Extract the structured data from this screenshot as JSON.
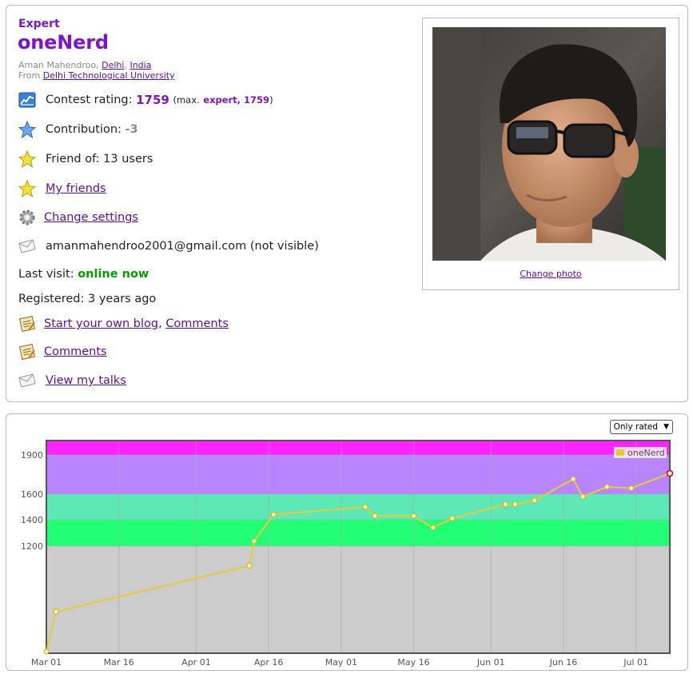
{
  "profile": {
    "rank": "Expert",
    "handle": "oneNerd",
    "name": "Aman Mahendroo",
    "city": "Delhi",
    "country": "India",
    "from_label": "From",
    "organization": "Delhi Technological University",
    "rating_label": "Contest rating:",
    "rating_value": "1759",
    "max_open": "(max.",
    "max_value": "expert, 1759",
    "max_close": ")",
    "contribution_label": "Contribution:",
    "contribution_value": "-3",
    "friend_of": "Friend of: 13 users",
    "my_friends": "My friends",
    "change_settings": "Change settings",
    "email": "amanmahendroo2001@gmail.com (not visible)",
    "last_visit_label": "Last visit:",
    "last_visit_value": "online now",
    "registered": "Registered: 3 years ago",
    "blog_link": "Start your own blog",
    "comments_link": "Comments",
    "comments_link_2": "Comments",
    "talks_link": "View my talks",
    "change_photo": "Change photo",
    "icons": [
      "rating-chart-icon",
      "blue-star-icon",
      "yellow-star-icon",
      "yellow-star-icon",
      "gear-icon",
      "envelope-icon",
      "blog-icon",
      "blog-icon",
      "envelope-icon"
    ],
    "colors": {
      "expert": "#7e14c9",
      "online": "#0a9a0a",
      "link": "#5a0f9a"
    }
  },
  "chart_controls": {
    "filter_selected": "Only rated"
  },
  "chart_data": {
    "type": "line",
    "title": "",
    "xlabel": "",
    "ylabel": "",
    "legend": {
      "entries": [
        "oneNerd"
      ],
      "position": "top-right"
    },
    "x_ticks": [
      "Mar 01",
      "Mar 16",
      "Apr 01",
      "Apr 16",
      "May 01",
      "May 16",
      "Jun 01",
      "Jun 16",
      "Jul 01"
    ],
    "x_tick_days": [
      0,
      15,
      31,
      46,
      61,
      76,
      92,
      107,
      122
    ],
    "x_range_days": [
      0,
      129
    ],
    "y_ticks": [
      1200,
      1400,
      1600,
      1900
    ],
    "rating_bands": [
      {
        "from": 0,
        "to": 1200,
        "color": "#cccccc"
      },
      {
        "from": 1200,
        "to": 1400,
        "color": "#22ff75"
      },
      {
        "from": 1400,
        "to": 1600,
        "color": "#5ee8b8"
      },
      {
        "from": 1600,
        "to": 1900,
        "color": "#b985ff"
      },
      {
        "from": 1900,
        "to": 2100,
        "color": "#ff23ff"
      }
    ],
    "grid": true,
    "series": [
      {
        "name": "oneNerd",
        "color": "#e6cc34",
        "x_days": [
          0,
          2,
          42,
          43,
          47,
          66,
          68,
          76,
          80,
          84,
          95,
          97,
          101,
          109,
          111,
          116,
          121,
          129
        ],
        "y": [
          0,
          455,
          976,
          1238,
          1440,
          1500,
          1430,
          1430,
          1340,
          1410,
          1520,
          1520,
          1550,
          1715,
          1580,
          1655,
          1645,
          1759
        ]
      }
    ]
  }
}
